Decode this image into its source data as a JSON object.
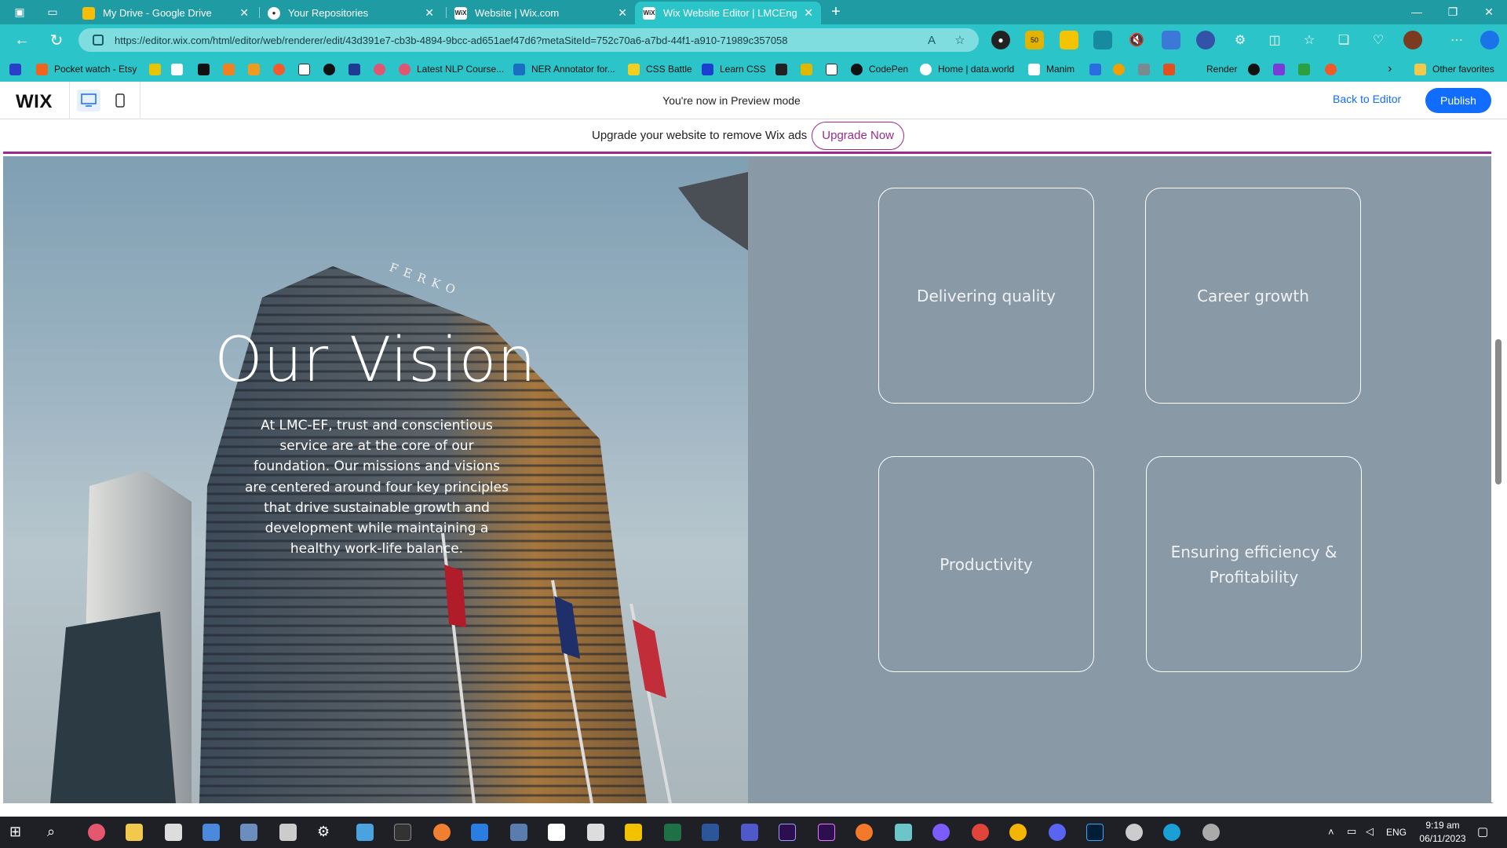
{
  "browser": {
    "tabs": [
      {
        "label": "My Drive - Google Drive",
        "icon": "drive-icon",
        "active": false
      },
      {
        "label": "Your Repositories",
        "icon": "github-icon",
        "active": false
      },
      {
        "label": "Website | Wix.com",
        "icon": "wix-icon",
        "active": false
      },
      {
        "label": "Wix Website Editor | LMCEngineer",
        "icon": "wix-icon",
        "active": true
      }
    ],
    "favicon_text": "WiX",
    "url": "https://editor.wix.com/html/editor/web/renderer/edit/43d391e7-cb3b-4894-9bcc-ad651aef47d6?metaSiteId=752c70a6-a7bd-44f1-a910-71989c357058",
    "extension_badge": "50",
    "favorites": [
      "Pocket watch - Etsy",
      "Latest NLP Course...",
      "NER Annotator for...",
      "CSS Battle",
      "Learn CSS",
      "CodePen",
      "Home | data.world",
      "Manim",
      "Render",
      "Other favorites"
    ]
  },
  "wix_bar": {
    "logo": "WIX",
    "status": "You're now in Preview mode",
    "back_label": "Back to Editor",
    "publish_label": "Publish"
  },
  "ad_banner": {
    "text": "Upgrade your website to remove Wix ads",
    "button": "Upgrade Now"
  },
  "hero": {
    "title": "Our Vision",
    "body": "At LMC-EF, trust and conscientious service are at the core of our foundation. Our missions and visions are centered around four key principles that drive sustainable growth and development while maintaining a healthy work-life balance.",
    "building_sign": "FERKO"
  },
  "cards": [
    {
      "label": "Delivering quality"
    },
    {
      "label": "Career growth"
    },
    {
      "label": "Productivity"
    },
    {
      "label": "Ensuring efficiency & Profitability"
    }
  ],
  "taskbar": {
    "time": "9:19 am",
    "date": "06/11/2023",
    "lang": "ENG"
  },
  "colors": {
    "browser_accent": "#2bc4c8",
    "wix_blue": "#116dff",
    "upgrade_purple": "#9b2a8f",
    "card_panel": "#8a99a6"
  }
}
